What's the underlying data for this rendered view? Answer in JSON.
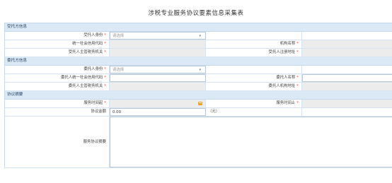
{
  "page": {
    "title": "涉税专业服务协议要素信息采集表"
  },
  "sections": {
    "trustee": "受托方信息",
    "client": "委托方信息",
    "agreement": "协议摘要"
  },
  "trustee": {
    "id_type_label": "受托人身份",
    "id_type_placeholder": "请选择",
    "credit_code_label": "统一社会信用代码",
    "org_name_label": "机构名称",
    "tax_office_label": "受托人主管税务机关",
    "reg_address_label": "受托人注册地址"
  },
  "client": {
    "id_type_label": "委托人身份",
    "id_type_placeholder": "请选择",
    "credit_code_label": "委托人统一社会信用代码",
    "name_label": "委托人名称",
    "tax_office_label": "委托人主管税务机关",
    "org_address_label": "委托人机构地址"
  },
  "agreement": {
    "start_label": "服务时间起",
    "end_label": "服务时间止",
    "amount_label": "协议金额",
    "amount_value": "0.00",
    "amount_unit": "（元）",
    "summary_label": "服务协议摘要"
  },
  "required_mark": "*",
  "icons": {
    "dropdown": "chevron-down-icon",
    "calendar": "calendar-icon"
  },
  "colors": {
    "section_bg": "#dbe8f6",
    "required": "#e64a3b",
    "readonly_bg": "#ececec",
    "calendar_icon": "#f0a023"
  }
}
